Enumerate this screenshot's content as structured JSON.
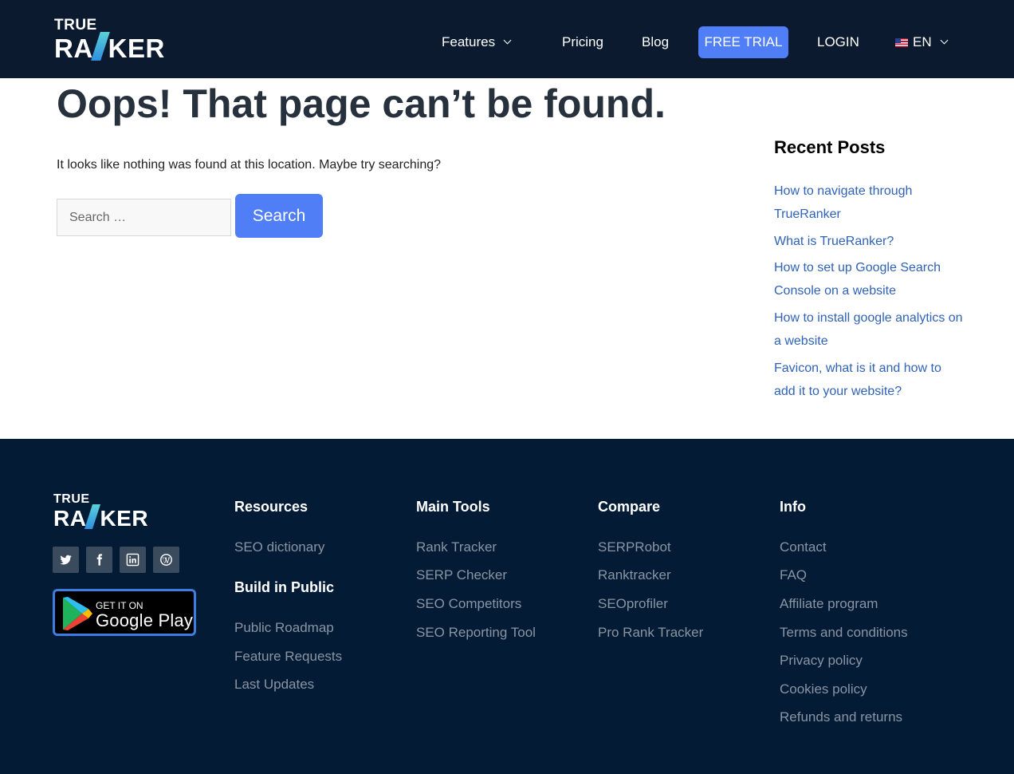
{
  "header": {
    "logo_top": "TRUE",
    "logo_main_left": "RA",
    "logo_main_right": "KER",
    "nav": {
      "features": "Features",
      "pricing": "Pricing",
      "blog": "Blog",
      "free_trial": "FREE TRIAL",
      "login": "LOGIN",
      "language": "EN"
    }
  },
  "main": {
    "title": "Oops! That page can’t be found.",
    "lead": "It looks like nothing was found at this location. Maybe try searching?",
    "search_placeholder": "Search …",
    "search_button": "Search"
  },
  "sidebar": {
    "title": "Recent Posts",
    "posts": [
      "How to navigate through TrueRanker",
      "What is TrueRanker?",
      "How to set up Google Search Console on a website",
      "How to install google analytics on a website",
      "Favicon, what is it and how to add it to your website?"
    ]
  },
  "footer": {
    "logo_top": "TRUE",
    "logo_main_left": "RA",
    "logo_main_right": "KER",
    "social": [
      "twitter-icon",
      "facebook-icon",
      "linkedin-icon",
      "wordpress-icon"
    ],
    "google_play": {
      "small": "GET IT ON",
      "big": "Google Play"
    },
    "resources": {
      "title": "Resources",
      "links": [
        "SEO dictionary"
      ]
    },
    "build_in_public": {
      "title": "Build in Public",
      "links": [
        "Public Roadmap",
        "Feature Requests",
        "Last Updates"
      ]
    },
    "main_tools": {
      "title": "Main Tools",
      "links": [
        "Rank Tracker",
        "SERP Checker",
        "SEO Competitors",
        "SEO Reporting Tool"
      ]
    },
    "compare": {
      "title": "Compare",
      "links": [
        "SERPRobot",
        "Ranktracker",
        "SEOprofiler",
        "Pro Rank Tracker"
      ]
    },
    "info": {
      "title": "Info",
      "links": [
        "Contact",
        "FAQ",
        "Affiliate program",
        "Terms and conditions",
        "Privacy policy",
        "Cookies policy",
        "Refunds and returns"
      ]
    }
  },
  "colors": {
    "header_bg": "#0c1a30",
    "footer_bg": "#041b35",
    "accent": "#4f7ef7",
    "link": "#2f62b8"
  }
}
